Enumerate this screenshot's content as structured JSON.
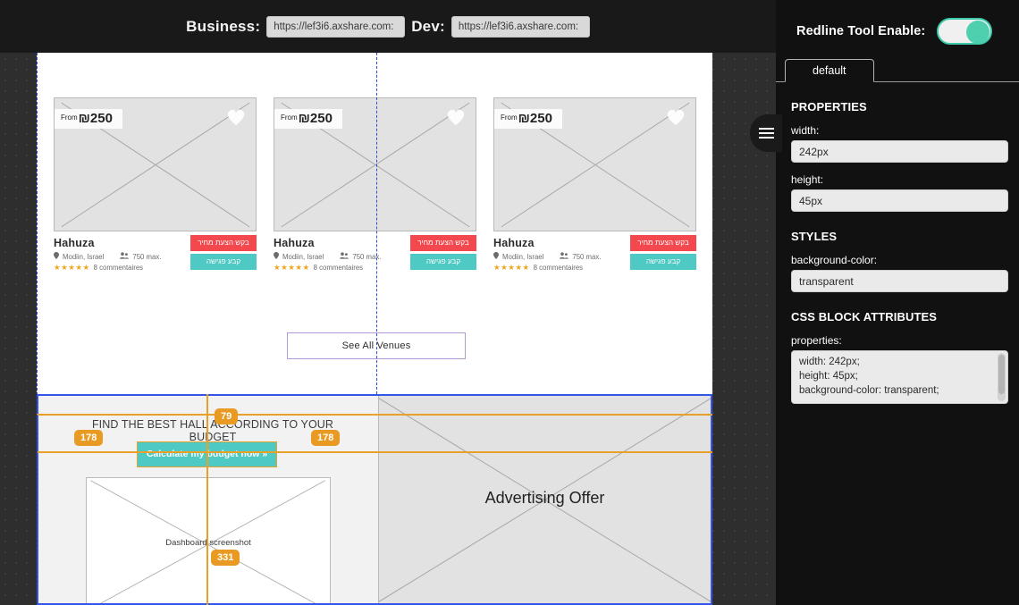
{
  "urlbar": {
    "business_label": "Business:",
    "business_url": "https://lef3i6.axshare.com:",
    "dev_label": "Dev:",
    "dev_url": "https://lef3i6.axshare.com:"
  },
  "panel": {
    "redline_label": "Redline Tool Enable:",
    "toggle_state": "on",
    "accent_color": "#4ecfae",
    "tab": "default",
    "properties_heading": "PROPERTIES",
    "width_label": "width:",
    "width_value": "242px",
    "height_label": "height:",
    "height_value": "45px",
    "styles_heading": "STYLES",
    "bgcolor_label": "background-color:",
    "bgcolor_value": "transparent",
    "css_heading": "CSS BLOCK ATTRIBUTES",
    "css_props_label": "properties:",
    "css_props_value": "width: 242px;\nheight: 45px;\nbackground-color: transparent;"
  },
  "cards": [
    {
      "price_from": "From",
      "price": "₪250",
      "title": "Hahuza",
      "location": "Modiin, Israel",
      "capacity": "750 max.",
      "stars": "★★★★★",
      "comments": "8 commentaires",
      "btn_quote": "בקש הצעת מחיר",
      "btn_meet": "קבע פגישה"
    },
    {
      "price_from": "From",
      "price": "₪250",
      "title": "Hahuza",
      "location": "Modiin, Israel",
      "capacity": "750 max.",
      "stars": "★★★★★",
      "comments": "8 commentaires",
      "btn_quote": "בקש הצעת מחיר",
      "btn_meet": "קבע פגישה"
    },
    {
      "price_from": "From",
      "price": "₪250",
      "title": "Hahuza",
      "location": "Modiin, Israel",
      "capacity": "750 max.",
      "stars": "★★★★★",
      "comments": "8 commentaires",
      "btn_quote": "בקש הצעת מחיר",
      "btn_meet": "קבע פגישה"
    }
  ],
  "see_all_label": "See All Venues",
  "lower": {
    "find_title": "FIND THE BEST HALL ACCORDING TO YOUR BUDGET",
    "calc_button": "Calculate my budget now »",
    "dashboard_label": "Dashboard screenshot",
    "ad_label": "Advertising Offer"
  },
  "redline": {
    "color": "#e89a22",
    "badges": [
      {
        "value": "79"
      },
      {
        "value": "178"
      },
      {
        "value": "178"
      },
      {
        "value": "331"
      }
    ]
  }
}
